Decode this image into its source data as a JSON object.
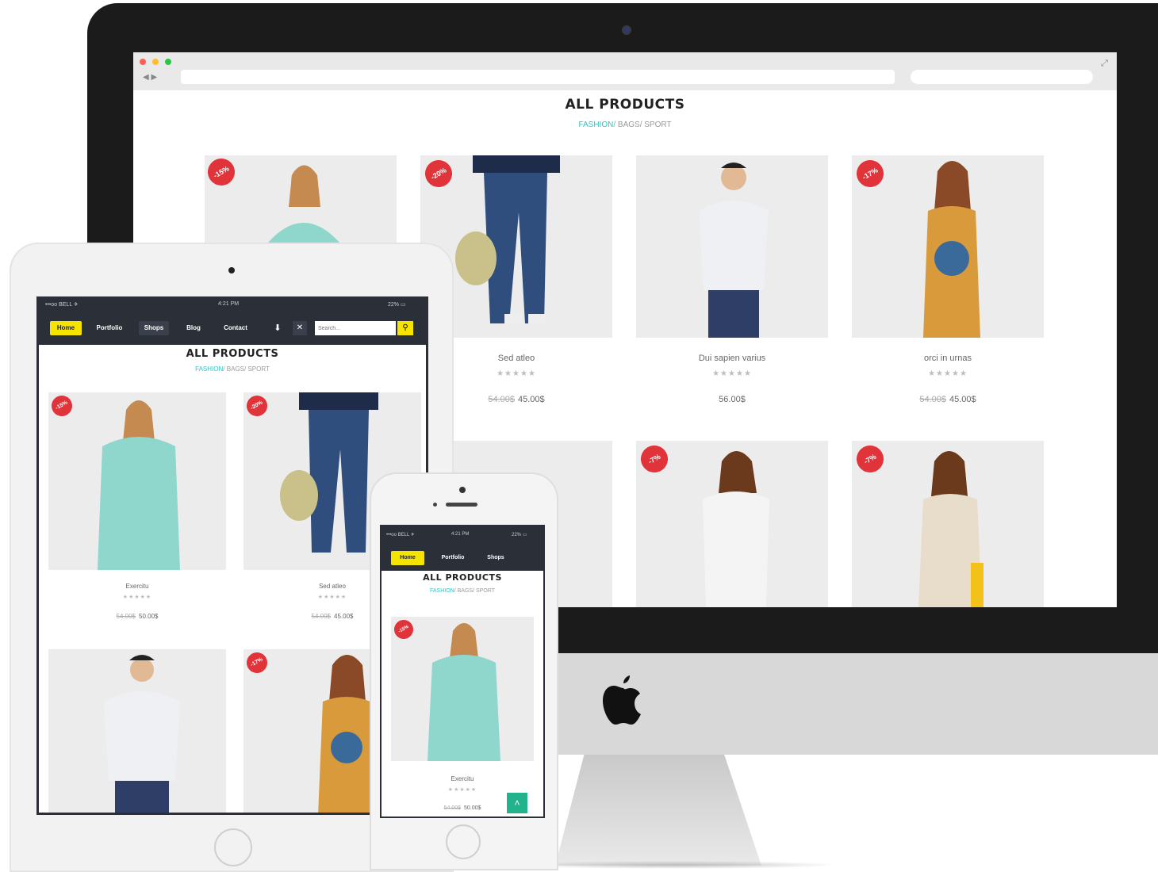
{
  "page": {
    "title": "ALL PRODUCTS",
    "categories": [
      {
        "label": "FASHION",
        "sep": "/"
      },
      {
        "label": "BAGS",
        "sep": "/"
      },
      {
        "label": "SPORT",
        "sep": ""
      }
    ]
  },
  "colors": {
    "accent": "#2ec4c4",
    "badge": "#e0333a",
    "nav_bg": "#2a2f38",
    "nav_active": "#f5e400",
    "scroll_top": "#22b38c"
  },
  "desktop": {
    "products_row1": [
      {
        "name": "",
        "badge": "-15%",
        "old_price": "",
        "price": ""
      },
      {
        "name": "Sed atleo",
        "badge": "-20%",
        "old_price": "54.00$",
        "price": "45.00$"
      },
      {
        "name": "Dui sapien varius",
        "badge": "",
        "old_price": "",
        "price": "56.00$"
      },
      {
        "name": "orci in urnas",
        "badge": "-17%",
        "old_price": "54.00$",
        "price": "45.00$"
      }
    ],
    "products_row2_badges": [
      "",
      "",
      "-7%",
      "-7%"
    ],
    "stars": "★★★★★"
  },
  "tablet": {
    "status": {
      "carrier": "•••oo BELL ✈",
      "time": "4:21 PM",
      "battery": "22% ▭"
    },
    "nav": [
      "Home",
      "Portfolio",
      "Shops",
      "Blog",
      "Contact"
    ],
    "search_placeholder": "Search...",
    "products": [
      {
        "name": "Exercitu",
        "badge": "-15%",
        "old_price": "54.00$",
        "price": "50.00$"
      },
      {
        "name": "Sed atleo",
        "badge": "-20%",
        "old_price": "54.00$",
        "price": "45.00$"
      },
      {
        "name": "",
        "badge": "",
        "old_price": "",
        "price": ""
      },
      {
        "name": "",
        "badge": "-17%",
        "old_price": "",
        "price": ""
      }
    ],
    "stars": "★★★★★"
  },
  "phone": {
    "status": {
      "carrier": "•••oo BELL ✈",
      "time": "4:21 PM",
      "battery": "22% ▭"
    },
    "nav": [
      "Home",
      "Portfolio",
      "Shops"
    ],
    "product": {
      "name": "Exercitu",
      "badge": "-15%",
      "old_price": "54.00$",
      "price": "50.00$"
    },
    "stars": "★★★★★",
    "scroll_top_icon": "chevron-up-icon"
  }
}
